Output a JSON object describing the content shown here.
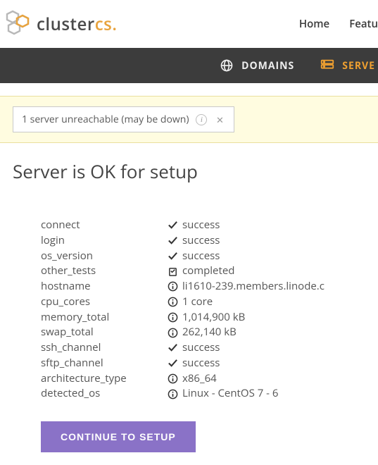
{
  "logo": {
    "word1": "cluster",
    "word2": "cs",
    "dot": "."
  },
  "top_nav": {
    "home": "Home",
    "features": "Featu"
  },
  "sub_nav": {
    "domains": "DOMAINS",
    "servers": "SERVE"
  },
  "alert": {
    "text": "1 server unreachable (may be down)"
  },
  "page_title": "Server is OK for setup",
  "checks": [
    {
      "label": "connect",
      "icon": "check",
      "value": "success"
    },
    {
      "label": "login",
      "icon": "check",
      "value": "success"
    },
    {
      "label": "os_version",
      "icon": "check",
      "value": "success"
    },
    {
      "label": "other_tests",
      "icon": "clip",
      "value": "completed"
    },
    {
      "label": "hostname",
      "icon": "info",
      "value": "li1610-239.members.linode.c"
    },
    {
      "label": "cpu_cores",
      "icon": "info",
      "value": "1 core"
    },
    {
      "label": "memory_total",
      "icon": "info",
      "value": "1,014,900 kB"
    },
    {
      "label": "swap_total",
      "icon": "info",
      "value": "262,140 kB"
    },
    {
      "label": "ssh_channel",
      "icon": "check",
      "value": "success"
    },
    {
      "label": "sftp_channel",
      "icon": "check",
      "value": "success"
    },
    {
      "label": "architecture_type",
      "icon": "info",
      "value": "x86_64"
    },
    {
      "label": "detected_os",
      "icon": "info",
      "value": "Linux - CentOS 7 - 6"
    }
  ],
  "continue_label": "CONTINUE TO SETUP"
}
